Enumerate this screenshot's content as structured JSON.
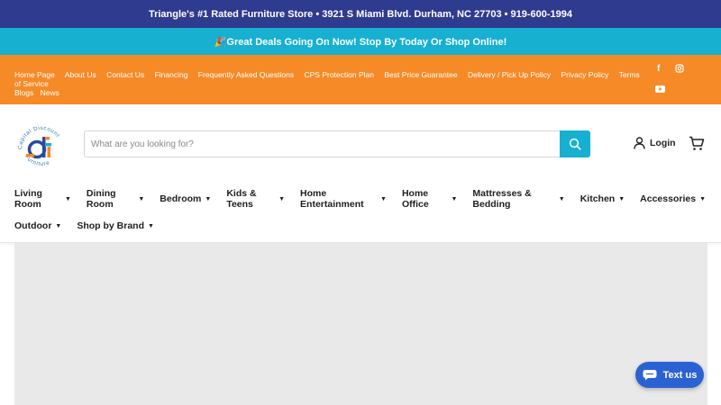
{
  "top_bar": {
    "text": "Triangle's #1 Rated Furniture Store • 3921 S Miami Blvd. Durham, NC 27703 • 919-600-1994"
  },
  "deals_bar": {
    "text": "🎉Great Deals Going On Now! Stop By Today Or Shop Online!"
  },
  "utility_links": [
    "Home Page",
    "About Us",
    "Contact Us",
    "Financing",
    "Frequently Asked Questions",
    "CPS Protection Plan",
    "Best Price Guarantee",
    "Delivery / Pick Up Policy",
    "Privacy Policy",
    "Terms of Service",
    "Blogs",
    "News"
  ],
  "social": {
    "facebook": "f",
    "instagram": "instagram-icon",
    "youtube": "youtube-icon"
  },
  "logo": {
    "arc_top": "Capital Discount",
    "arc_bottom": "Furniture",
    "monogram": "df"
  },
  "search": {
    "placeholder": "What are you looking for?"
  },
  "account": {
    "login_label": "Login"
  },
  "nav_row1": [
    "Living Room",
    "Dining Room",
    "Bedroom",
    "Kids & Teens",
    "Home Entertainment",
    "Home Office",
    "Mattresses & Bedding",
    "Kitchen",
    "Accessories"
  ],
  "nav_row2": [
    "Outdoor",
    "Shop by Brand"
  ],
  "chat": {
    "label": "Text us"
  },
  "colors": {
    "top_bar": "#2e3b8e",
    "deals_bar": "#17b0d1",
    "utility_bar": "#f58a27",
    "search_button": "#17b0d1",
    "chat_button": "#2b62d3"
  }
}
